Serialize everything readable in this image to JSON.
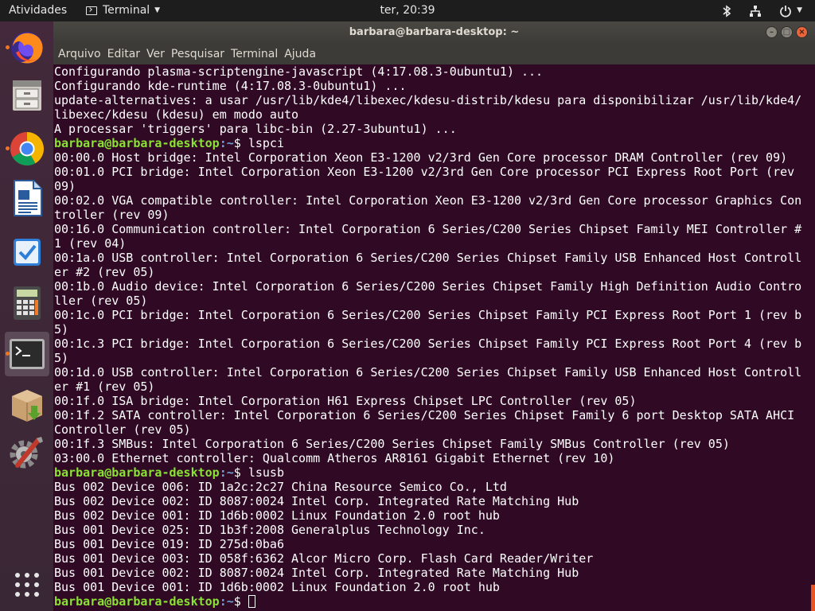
{
  "topbar": {
    "activities": "Atividades",
    "app_name": "Terminal",
    "clock": "ter, 20:39"
  },
  "dock": {
    "apps": [
      {
        "name": "Firefox",
        "icon": "firefox-icon",
        "running": true
      },
      {
        "name": "Arquivos",
        "icon": "files-icon",
        "running": false
      },
      {
        "name": "Google Chrome",
        "icon": "chrome-icon",
        "running": true
      },
      {
        "name": "LibreOffice Writer",
        "icon": "writer-icon",
        "running": false
      },
      {
        "name": "Tarefas",
        "icon": "tasks-icon",
        "running": false
      },
      {
        "name": "Calculadora",
        "icon": "calculator-icon",
        "running": false
      },
      {
        "name": "Terminal",
        "icon": "terminal-icon",
        "running": true
      },
      {
        "name": "Instalador de pacotes",
        "icon": "package-installer-icon",
        "running": false
      },
      {
        "name": "Configurações",
        "icon": "settings-tools-icon",
        "running": false
      }
    ],
    "show_apps_icon": "app-grid-icon"
  },
  "window": {
    "title": "barbara@barbara-desktop: ~",
    "menu": [
      "Arquivo",
      "Editar",
      "Ver",
      "Pesquisar",
      "Terminal",
      "Ajuda"
    ]
  },
  "terminal": {
    "prompt_user": "barbara@barbara-desktop",
    "prompt_path": ":~",
    "prompt_symbol": "$ ",
    "lines": [
      {
        "t": "out",
        "text": "Configurando plasma-scriptengine-javascript (4:17.08.3-0ubuntu1) ..."
      },
      {
        "t": "out",
        "text": "Configurando kde-runtime (4:17.08.3-0ubuntu1) ..."
      },
      {
        "t": "out",
        "text": "update-alternatives: a usar /usr/lib/kde4/libexec/kdesu-distrib/kdesu para disponibilizar /usr/lib/kde4/"
      },
      {
        "t": "out",
        "text": "libexec/kdesu (kdesu) em modo auto"
      },
      {
        "t": "out",
        "text": "A processar 'triggers' para libc-bin (2.27-3ubuntu1) ..."
      },
      {
        "t": "cmd",
        "text": "lspci"
      },
      {
        "t": "out",
        "text": "00:00.0 Host bridge: Intel Corporation Xeon E3-1200 v2/3rd Gen Core processor DRAM Controller (rev 09)"
      },
      {
        "t": "out",
        "text": "00:01.0 PCI bridge: Intel Corporation Xeon E3-1200 v2/3rd Gen Core processor PCI Express Root Port (rev"
      },
      {
        "t": "out",
        "text": "09)"
      },
      {
        "t": "out",
        "text": "00:02.0 VGA compatible controller: Intel Corporation Xeon E3-1200 v2/3rd Gen Core processor Graphics Con"
      },
      {
        "t": "out",
        "text": "troller (rev 09)"
      },
      {
        "t": "out",
        "text": "00:16.0 Communication controller: Intel Corporation 6 Series/C200 Series Chipset Family MEI Controller #"
      },
      {
        "t": "out",
        "text": "1 (rev 04)"
      },
      {
        "t": "out",
        "text": "00:1a.0 USB controller: Intel Corporation 6 Series/C200 Series Chipset Family USB Enhanced Host Controll"
      },
      {
        "t": "out",
        "text": "er #2 (rev 05)"
      },
      {
        "t": "out",
        "text": "00:1b.0 Audio device: Intel Corporation 6 Series/C200 Series Chipset Family High Definition Audio Contro"
      },
      {
        "t": "out",
        "text": "ller (rev 05)"
      },
      {
        "t": "out",
        "text": "00:1c.0 PCI bridge: Intel Corporation 6 Series/C200 Series Chipset Family PCI Express Root Port 1 (rev b"
      },
      {
        "t": "out",
        "text": "5)"
      },
      {
        "t": "out",
        "text": "00:1c.3 PCI bridge: Intel Corporation 6 Series/C200 Series Chipset Family PCI Express Root Port 4 (rev b"
      },
      {
        "t": "out",
        "text": "5)"
      },
      {
        "t": "out",
        "text": "00:1d.0 USB controller: Intel Corporation 6 Series/C200 Series Chipset Family USB Enhanced Host Controll"
      },
      {
        "t": "out",
        "text": "er #1 (rev 05)"
      },
      {
        "t": "out",
        "text": "00:1f.0 ISA bridge: Intel Corporation H61 Express Chipset LPC Controller (rev 05)"
      },
      {
        "t": "out",
        "text": "00:1f.2 SATA controller: Intel Corporation 6 Series/C200 Series Chipset Family 6 port Desktop SATA AHCI"
      },
      {
        "t": "out",
        "text": "Controller (rev 05)"
      },
      {
        "t": "out",
        "text": "00:1f.3 SMBus: Intel Corporation 6 Series/C200 Series Chipset Family SMBus Controller (rev 05)"
      },
      {
        "t": "out",
        "text": "03:00.0 Ethernet controller: Qualcomm Atheros AR8161 Gigabit Ethernet (rev 10)"
      },
      {
        "t": "cmd",
        "text": "lsusb"
      },
      {
        "t": "out",
        "text": "Bus 002 Device 006: ID 1a2c:2c27 China Resource Semico Co., Ltd"
      },
      {
        "t": "out",
        "text": "Bus 002 Device 002: ID 8087:0024 Intel Corp. Integrated Rate Matching Hub"
      },
      {
        "t": "out",
        "text": "Bus 002 Device 001: ID 1d6b:0002 Linux Foundation 2.0 root hub"
      },
      {
        "t": "out",
        "text": "Bus 001 Device 025: ID 1b3f:2008 Generalplus Technology Inc."
      },
      {
        "t": "out",
        "text": "Bus 001 Device 019: ID 275d:0ba6"
      },
      {
        "t": "out",
        "text": "Bus 001 Device 003: ID 058f:6362 Alcor Micro Corp. Flash Card Reader/Writer"
      },
      {
        "t": "out",
        "text": "Bus 001 Device 002: ID 8087:0024 Intel Corp. Integrated Rate Matching Hub"
      },
      {
        "t": "out",
        "text": "Bus 001 Device 001: ID 1d6b:0002 Linux Foundation 2.0 root hub"
      },
      {
        "t": "cmd",
        "text": ""
      }
    ]
  },
  "colors": {
    "terminal_bg": "#300a24",
    "prompt_user": "#8ae234",
    "prompt_path": "#729fcf",
    "accent": "#e95420"
  }
}
